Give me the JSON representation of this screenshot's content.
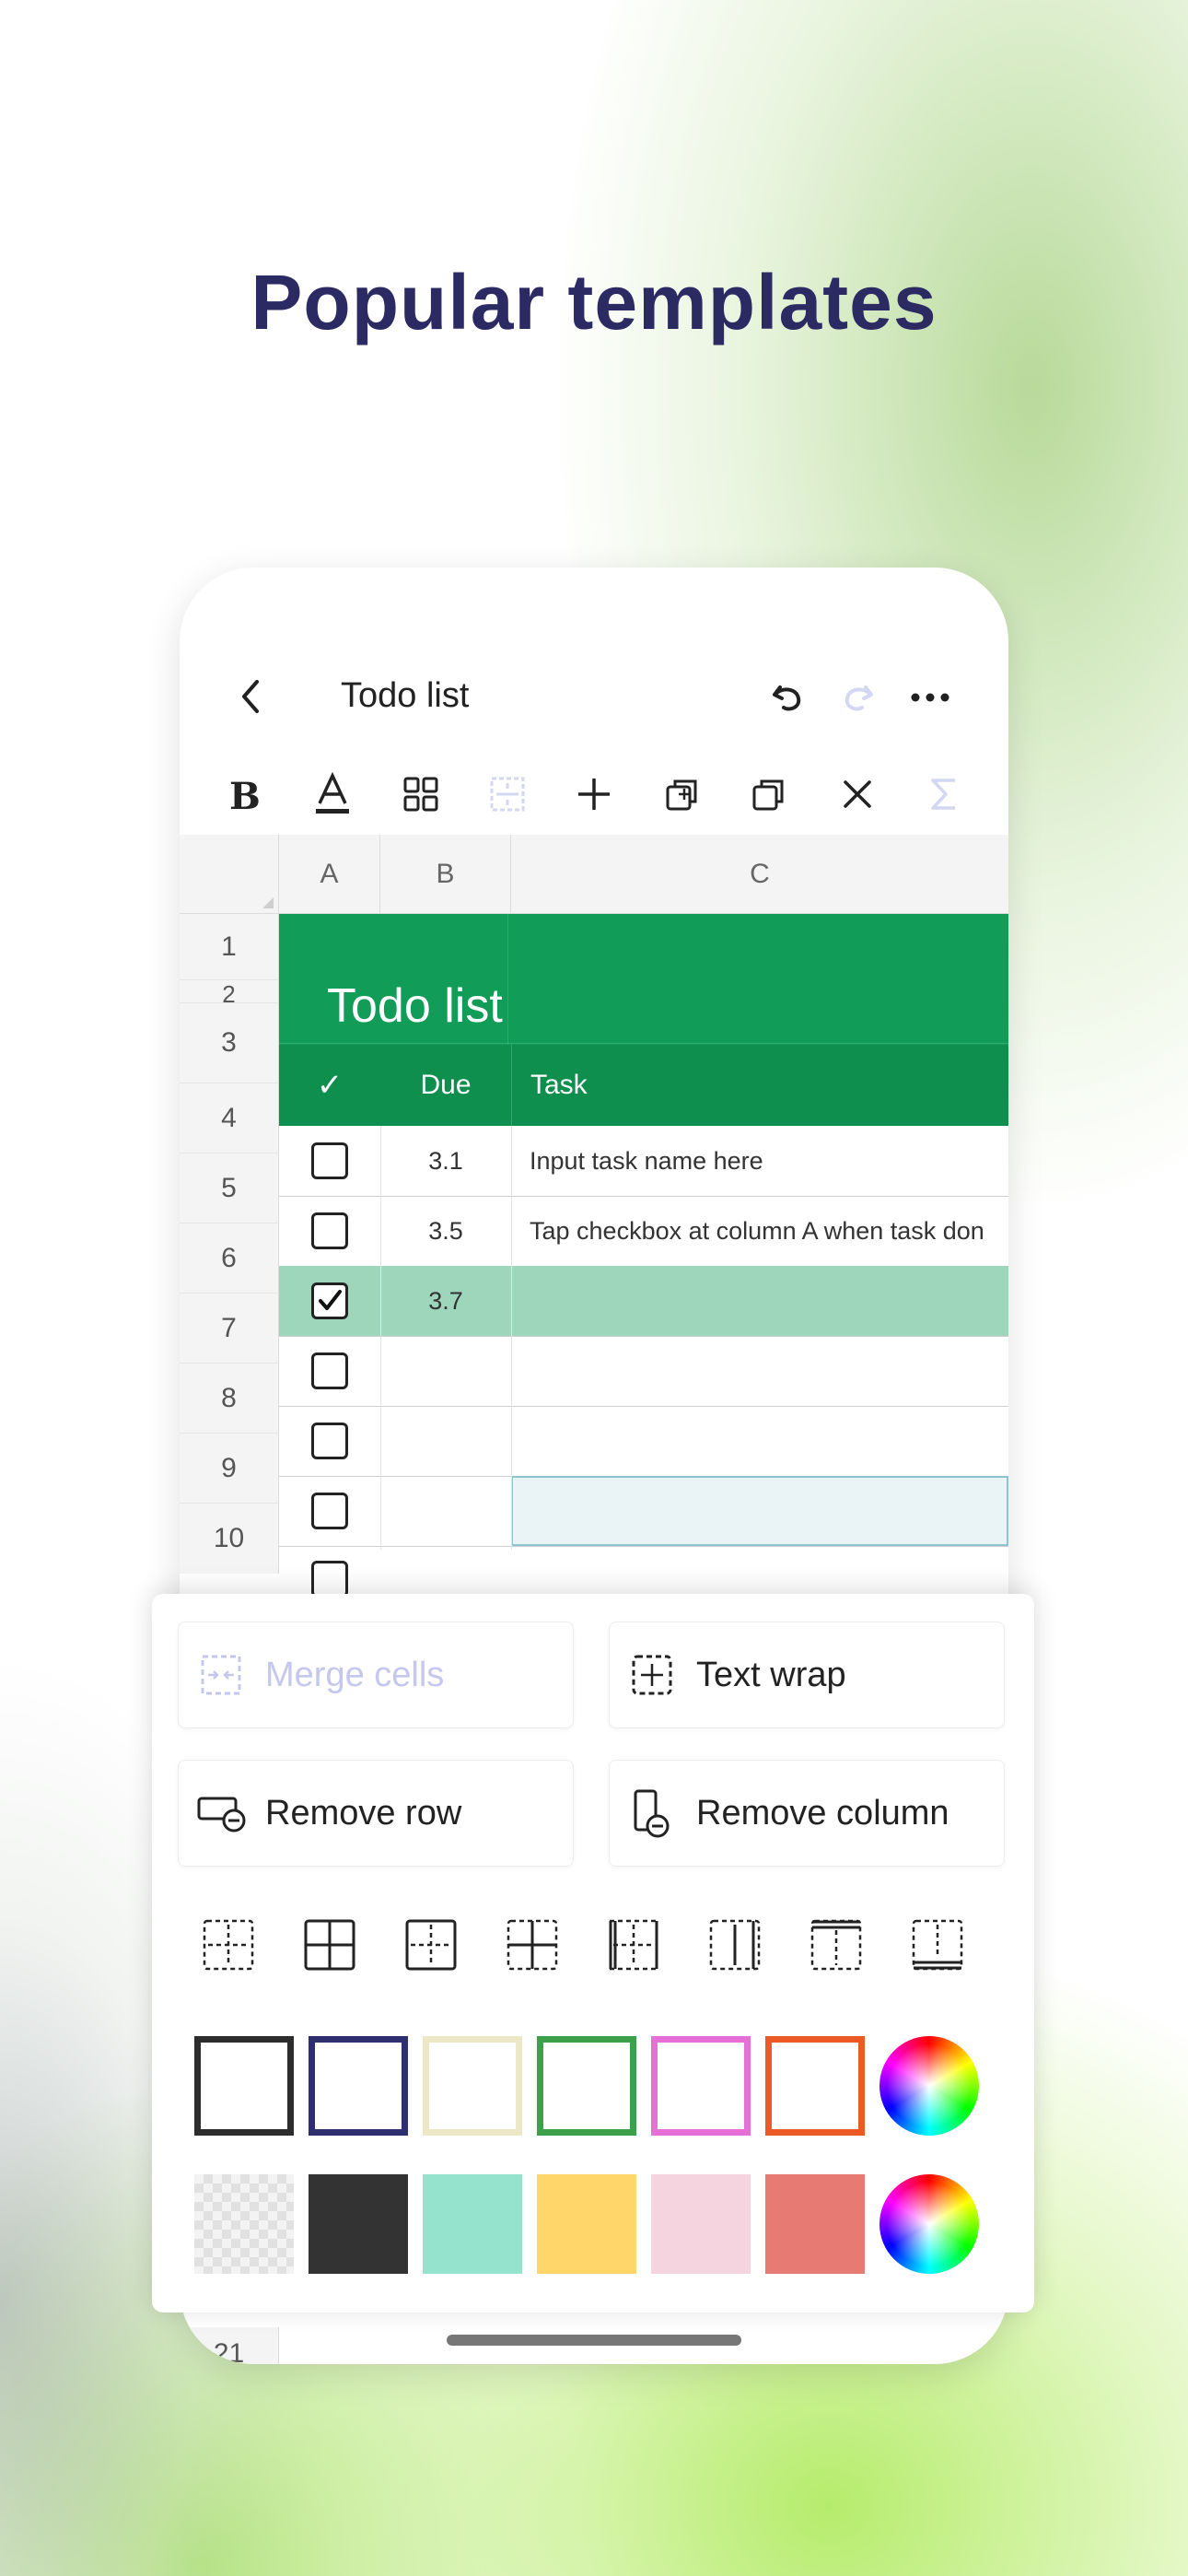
{
  "headline": "Popular templates",
  "nav": {
    "title": "Todo list"
  },
  "columns": [
    "A",
    "B",
    "C"
  ],
  "rows": [
    "1",
    "2",
    "3",
    "4",
    "5",
    "6",
    "7",
    "8",
    "9",
    "10",
    "21"
  ],
  "sheet": {
    "banner_title": "Todo list",
    "header_check": "✓",
    "header_due": "Due",
    "header_task": "Task",
    "data": [
      {
        "row": "4",
        "checked": false,
        "due": "3.1",
        "task": "Input task name here"
      },
      {
        "row": "5",
        "checked": false,
        "due": "3.5",
        "task": "Tap checkbox at column A when task don"
      },
      {
        "row": "6",
        "checked": true,
        "due": "3.7",
        "task": ""
      },
      {
        "row": "7",
        "checked": false,
        "due": "",
        "task": ""
      },
      {
        "row": "8",
        "checked": false,
        "due": "",
        "task": ""
      },
      {
        "row": "9",
        "checked": false,
        "due": "",
        "task": ""
      },
      {
        "row": "10",
        "checked": false,
        "due": "",
        "task": ""
      }
    ]
  },
  "panel": {
    "merge_cells": "Merge cells",
    "text_wrap": "Text wrap",
    "remove_row": "Remove row",
    "remove_column": "Remove column"
  },
  "colors": {
    "banner": "#119d57",
    "header_row": "#0f8f4e",
    "checked_row": "#9ed6bb",
    "selected_cell": "#eaf3f5",
    "border_colors": [
      "#2d2d2d",
      "#2d2f6e",
      "#ece8c7",
      "#3ea04a",
      "#e66fd8",
      "#ee5a26"
    ],
    "fill_colors": [
      "transparent",
      "#333333",
      "#95e3cd",
      "#fed66a",
      "#f6d4df",
      "#e77a73"
    ]
  }
}
